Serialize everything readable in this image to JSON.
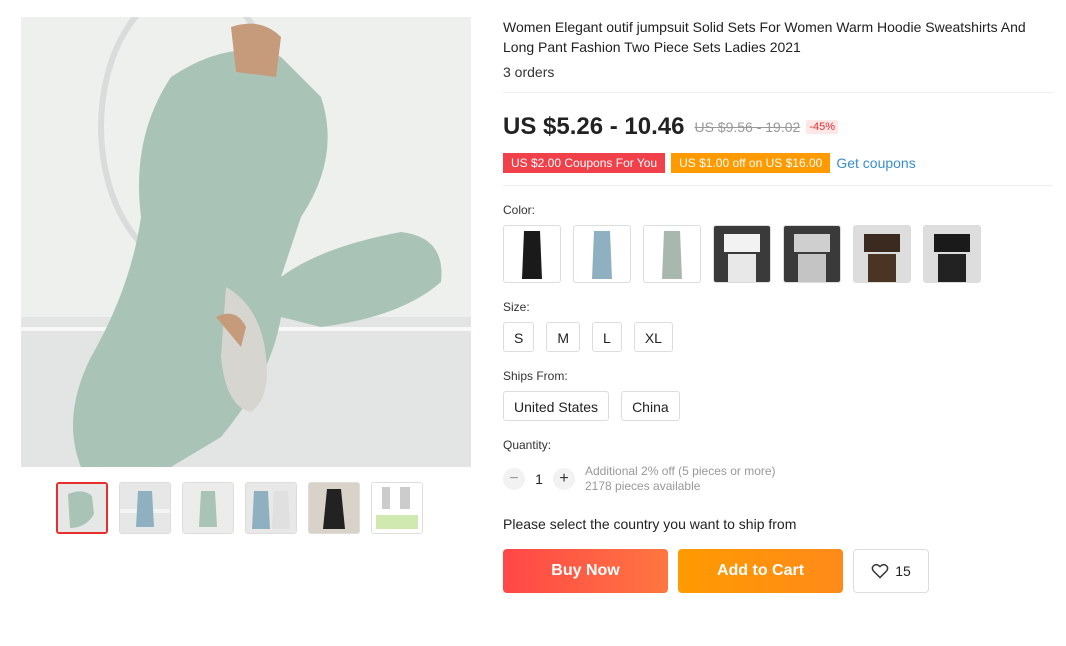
{
  "product": {
    "title": "Women Elegant outif jumpsuit Solid Sets For Women Warm Hoodie Sweatshirts And Long Pant Fashion Two Piece Sets Ladies 2021",
    "orders": "3 orders"
  },
  "price": {
    "current": "US $5.26 - 10.46",
    "original": "US $9.56 - 19.02",
    "discount": "-45%"
  },
  "coupons": {
    "coupon1": "US $2.00 Coupons For You",
    "coupon2": "US $1.00 off on US $16.00",
    "get_link": "Get coupons"
  },
  "color": {
    "label": "Color:",
    "options": [
      "black",
      "blue",
      "sage",
      "white-crop",
      "grey-crop",
      "brown-crop",
      "black-crop"
    ]
  },
  "size": {
    "label": "Size:",
    "options": [
      "S",
      "M",
      "L",
      "XL"
    ]
  },
  "ships_from": {
    "label": "Ships From:",
    "options": [
      "United States",
      "China"
    ]
  },
  "quantity": {
    "label": "Quantity:",
    "value": "1",
    "note1": "Additional 2% off (5 pieces or more)",
    "note2": "2178 pieces available"
  },
  "ship_msg": "Please select the country you want to ship from",
  "actions": {
    "buy": "Buy Now",
    "cart": "Add to Cart",
    "wish_count": "15"
  },
  "colors": {
    "main_bg": "#e9ecea",
    "sage": "#a9c4b6",
    "buy": "#ff4747",
    "cart": "#ff9a00",
    "link": "#3a8ec9"
  }
}
